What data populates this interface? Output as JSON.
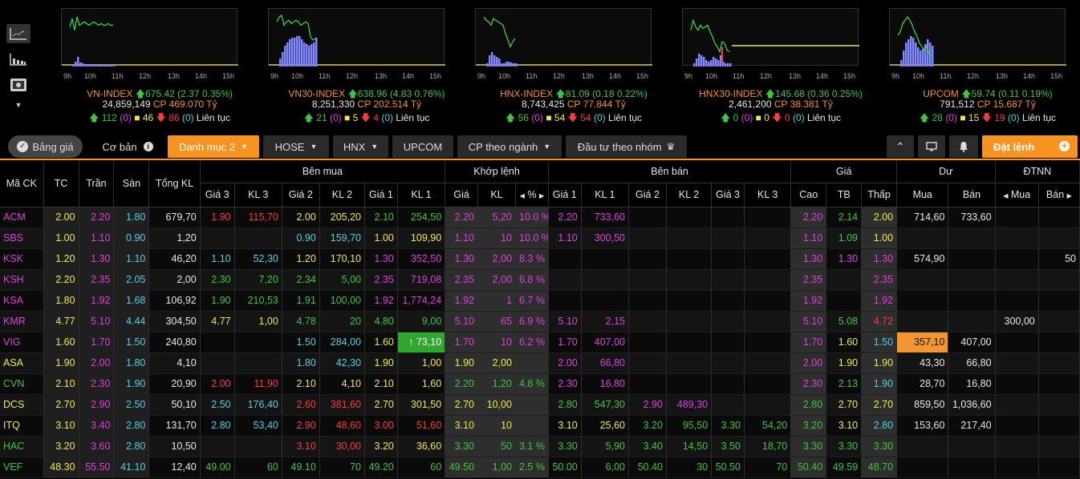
{
  "indices": [
    {
      "name": "VN-INDEX",
      "value": "675.42",
      "change": "(2.37 0.35%)",
      "volume": "24,859,149",
      "cp_label": "CP",
      "cp_value": "469.070 Tỷ",
      "up": "112",
      "up_ceil": "(0)",
      "flat": "46",
      "down": "86",
      "down_floor": "(0)",
      "status": "Liên tục"
    },
    {
      "name": "VN30-INDEX",
      "value": "638.96",
      "change": "(4.83 0.76%)",
      "volume": "8,251,330",
      "cp_label": "CP",
      "cp_value": "202.514 Tỷ",
      "up": "21",
      "up_ceil": "(0)",
      "flat": "5",
      "down": "4",
      "down_floor": "(0)",
      "status": "Liên tục"
    },
    {
      "name": "HNX-INDEX",
      "value": "81.09",
      "change": "(0.18 0.22%)",
      "volume": "8,743,425",
      "cp_label": "CP",
      "cp_value": "77.844 Tỷ",
      "up": "56",
      "up_ceil": "(0)",
      "flat": "54",
      "down": "54",
      "down_floor": "(0)",
      "status": "Liên tục"
    },
    {
      "name": "HNX30-INDEX",
      "value": "145.68",
      "change": "(0.36 0.25%)",
      "volume": "2,461,200",
      "cp_label": "CP",
      "cp_value": "38.381 Tỷ",
      "up": "0",
      "up_ceil": "(0)",
      "flat": "0",
      "down": "0",
      "down_floor": "(0)",
      "status": "Liên tục"
    },
    {
      "name": "UPCOM",
      "value": "59.74",
      "change": "(0.11 0.19%)",
      "volume": "791,512",
      "cp_label": "CP",
      "cp_value": "15.687 Tỷ",
      "up": "28",
      "up_ceil": "(0)",
      "flat": "15",
      "down": "19",
      "down_floor": "(0)",
      "status": "Liên tục"
    }
  ],
  "chart_ticks": [
    "9h",
    "10h",
    "11h",
    "12h",
    "13h",
    "14h",
    "15h"
  ],
  "nav": {
    "bang_gia": "Bảng giá",
    "co_ban": "Cơ bản",
    "tabs": [
      "Danh mục 2",
      "HOSE",
      "HNX",
      "UPCOM",
      "CP theo ngành",
      "Đầu tư theo nhóm"
    ],
    "dat_lenh": "Đặt lệnh"
  },
  "table": {
    "top_headers": {
      "ma_ck": "Mã CK",
      "tc": "TC",
      "tran": "Trần",
      "san": "Sàn",
      "tong_kl": "Tổng KL",
      "ben_mua": "Bên mua",
      "khop_lenh": "Khớp lệnh",
      "ben_ban": "Bên bán",
      "gia": "Giá",
      "du": "Dư",
      "dtnn": "ĐTNN"
    },
    "sub_headers": {
      "gia3": "Giá 3",
      "kl3": "KL 3",
      "gia2": "Giá 2",
      "kl2": "KL 2",
      "gia1": "Giá 1",
      "kl1": "KL 1",
      "kgia": "Giá",
      "kkl": "KL",
      "kpct": "%",
      "cao": "Cao",
      "tb": "TB",
      "thap": "Thấp",
      "mua": "Mua",
      "ban": "Bán",
      "nmua": "Mua",
      "nban": "Bán"
    },
    "rows": [
      {
        "sym": "ACM",
        "tc": "2.00",
        "tran": "2.20",
        "san": "1.80",
        "tkl": "679,70",
        "bg3": "1.90",
        "bk3": "115,70",
        "bg2": "2.00",
        "bk2": "205,20",
        "bg1": "2.10",
        "bk1": "254,50",
        "mg": "2.20",
        "mk": "5,20",
        "mp": "10.0 %",
        "sg1": "2.20",
        "sk1": "733,60",
        "sg2": "",
        "sk2": "",
        "sg3": "",
        "sk3": "",
        "cao": "2.20",
        "tb": "2.14",
        "thap": "2.00",
        "dmua": "714,60",
        "dban": "733,60",
        "nmua": "",
        "nban": ""
      },
      {
        "sym": "SBS",
        "tc": "1.00",
        "tran": "1.10",
        "san": "0.90",
        "tkl": "1,20",
        "bg3": "",
        "bk3": "",
        "bg2": "0.90",
        "bk2": "159,70",
        "bg1": "1.00",
        "bk1": "109,90",
        "mg": "1.10",
        "mk": "10",
        "mp": "10.0 %",
        "sg1": "1.10",
        "sk1": "300,50",
        "sg2": "",
        "sk2": "",
        "sg3": "",
        "sk3": "",
        "cao": "1.10",
        "tb": "1.09",
        "thap": "1.00",
        "dmua": "",
        "dban": "",
        "nmua": "",
        "nban": ""
      },
      {
        "sym": "KSK",
        "tc": "1.20",
        "tran": "1.30",
        "san": "1.10",
        "tkl": "46,20",
        "bg3": "1.10",
        "bk3": "52,30",
        "bg2": "1.20",
        "bk2": "170,10",
        "bg1": "1.30",
        "bk1": "352,50",
        "mg": "1.30",
        "mk": "2,00",
        "mp": "8.3 %",
        "sg1": "",
        "sk1": "",
        "sg2": "",
        "sk2": "",
        "sg3": "",
        "sk3": "",
        "cao": "1.30",
        "tb": "1.30",
        "thap": "1.30",
        "dmua": "574,90",
        "dban": "",
        "nmua": "",
        "nban": "50"
      },
      {
        "sym": "KSH",
        "tc": "2.20",
        "tran": "2.35",
        "san": "2.05",
        "tkl": "2,00",
        "bg3": "2.30",
        "bk3": "7,20",
        "bg2": "2.34",
        "bk2": "5,00",
        "bg1": "2.35",
        "bk1": "719,08",
        "mg": "2.35",
        "mk": "2,00",
        "mp": "6.8 %",
        "sg1": "",
        "sk1": "",
        "sg2": "",
        "sk2": "",
        "sg3": "",
        "sk3": "",
        "cao": "2.35",
        "tb": "",
        "thap": "2.35",
        "dmua": "",
        "dban": "",
        "nmua": "",
        "nban": ""
      },
      {
        "sym": "KSA",
        "tc": "1.80",
        "tran": "1.92",
        "san": "1.68",
        "tkl": "106,92",
        "bg3": "1.90",
        "bk3": "210,53",
        "bg2": "1.91",
        "bk2": "100,00",
        "bg1": "1.92",
        "bk1": "1,774,24",
        "mg": "1.92",
        "mk": "1",
        "mp": "6.7 %",
        "sg1": "",
        "sk1": "",
        "sg2": "",
        "sk2": "",
        "sg3": "",
        "sk3": "",
        "cao": "1.92",
        "tb": "",
        "thap": "1.92",
        "dmua": "",
        "dban": "",
        "nmua": "",
        "nban": ""
      },
      {
        "sym": "KMR",
        "tc": "4.77",
        "tran": "5.10",
        "san": "4.44",
        "tkl": "304,50",
        "bg3": "4.77",
        "bk3": "1,00",
        "bg2": "4.78",
        "bk2": "20",
        "bg1": "4.80",
        "bk1": "9,00",
        "mg": "5.10",
        "mk": "65",
        "mp": "6.9 %",
        "sg1": "5.10",
        "sk1": "2,15",
        "sg2": "",
        "sk2": "",
        "sg3": "",
        "sk3": "",
        "cao": "5.10",
        "tb": "5.08",
        "thap": "4.72",
        "dmua": "",
        "dban": "",
        "nmua": "300,00",
        "nban": ""
      },
      {
        "sym": "VIG",
        "tc": "1.60",
        "tran": "1.70",
        "san": "1.50",
        "tkl": "240,80",
        "bg3": "",
        "bk3": "",
        "bg2": "1.50",
        "bk2": "284,00",
        "bg1": "1.60",
        "bk1": "↑ 73,10",
        "mg": "1.70",
        "mk": "10",
        "mp": "6.2 %",
        "sg1": "1.70",
        "sk1": "407,00",
        "sg2": "",
        "sk2": "",
        "sg3": "",
        "sk3": "",
        "cao": "1.70",
        "tb": "1.60",
        "thap": "1.50",
        "dmua": "357,10",
        "dban": "407,00",
        "nmua": "",
        "nban": ""
      },
      {
        "sym": "ASA",
        "tc": "1.90",
        "tran": "2.00",
        "san": "1.80",
        "tkl": "4,10",
        "bg3": "",
        "bk3": "",
        "bg2": "1.80",
        "bk2": "42,30",
        "bg1": "1.90",
        "bk1": "1,00",
        "mg": "1.90",
        "mk": "2,00",
        "mp": "",
        "sg1": "2.00",
        "sk1": "66,80",
        "sg2": "",
        "sk2": "",
        "sg3": "",
        "sk3": "",
        "cao": "2.00",
        "tb": "1.90",
        "thap": "1.90",
        "dmua": "43,30",
        "dban": "66,80",
        "nmua": "",
        "nban": ""
      },
      {
        "sym": "CVN",
        "tc": "2.10",
        "tran": "2.30",
        "san": "1.90",
        "tkl": "20,90",
        "bg3": "2.00",
        "bk3": "11,90",
        "bg2": "2.10",
        "bk2": "4,10",
        "bg1": "2.10",
        "bk1": "1,60",
        "mg": "2.20",
        "mk": "1,20",
        "mp": "4.8 %",
        "sg1": "2.30",
        "sk1": "16,80",
        "sg2": "",
        "sk2": "",
        "sg3": "",
        "sk3": "",
        "cao": "2.30",
        "tb": "2.13",
        "thap": "1.90",
        "dmua": "28,70",
        "dban": "16,80",
        "nmua": "",
        "nban": ""
      },
      {
        "sym": "DCS",
        "tc": "2.70",
        "tran": "2.90",
        "san": "2.50",
        "tkl": "50,10",
        "bg3": "2.50",
        "bk3": "176,40",
        "bg2": "2.60",
        "bk2": "381,60",
        "bg1": "2.70",
        "bk1": "301,50",
        "mg": "2.70",
        "mk": "10,00",
        "mp": "",
        "sg1": "2.80",
        "sk1": "547,30",
        "sg2": "2.90",
        "sk2": "489,30",
        "sg3": "",
        "sk3": "",
        "cao": "2.80",
        "tb": "2.70",
        "thap": "2.70",
        "dmua": "859,50",
        "dban": "1,036,60",
        "nmua": "",
        "nban": ""
      },
      {
        "sym": "ITQ",
        "tc": "3.10",
        "tran": "3.40",
        "san": "2.80",
        "tkl": "131,70",
        "bg3": "2.80",
        "bk3": "53,40",
        "bg2": "2.90",
        "bk2": "48,60",
        "bg1": "3.00",
        "bk1": "51,60",
        "mg": "3.10",
        "mk": "10",
        "mp": "",
        "sg1": "3.10",
        "sk1": "25,60",
        "sg2": "3.20",
        "sk2": "95,50",
        "sg3": "3.30",
        "sk3": "54,20",
        "cao": "3.20",
        "tb": "3.10",
        "thap": "2.80",
        "dmua": "153,60",
        "dban": "217,40",
        "nmua": "",
        "nban": ""
      },
      {
        "sym": "HAC",
        "tc": "3.20",
        "tran": "3.60",
        "san": "2.80",
        "tkl": "10,50",
        "bg3": "",
        "bk3": "",
        "bg2": "3.10",
        "bk2": "30,00",
        "bg1": "3.20",
        "bk1": "36,60",
        "mg": "3.30",
        "mk": "50",
        "mp": "3.1 %",
        "sg1": "3.30",
        "sk1": "5,90",
        "sg2": "3.40",
        "sk2": "14,50",
        "sg3": "3.50",
        "sk3": "18,70",
        "cao": "3.30",
        "tb": "3.30",
        "thap": "3.30",
        "dmua": "",
        "dban": "",
        "nmua": "",
        "nban": ""
      },
      {
        "sym": "VEF",
        "tc": "48.30",
        "tran": "55.50",
        "san": "41.10",
        "tkl": "12,40",
        "bg3": "49.00",
        "bk3": "60",
        "bg2": "49.10",
        "bk2": "70",
        "bg1": "49.20",
        "bk1": "60",
        "mg": "49.50",
        "mk": "1,00",
        "mp": "2.5 %",
        "sg1": "50.00",
        "sk1": "6,00",
        "sg2": "50.40",
        "sk2": "30",
        "sg3": "50.50",
        "sk3": "70",
        "cao": "50.40",
        "tb": "49.59",
        "thap": "48.70",
        "dmua": "",
        "dban": "",
        "nmua": "",
        "nban": ""
      }
    ]
  },
  "colors": {
    "ceiling": "#e13ee1",
    "reference": "#f2e84a",
    "floor": "#4fd0e8",
    "up": "#3fc63f",
    "down": "#ff3b3b",
    "accent": "#f7931e"
  }
}
